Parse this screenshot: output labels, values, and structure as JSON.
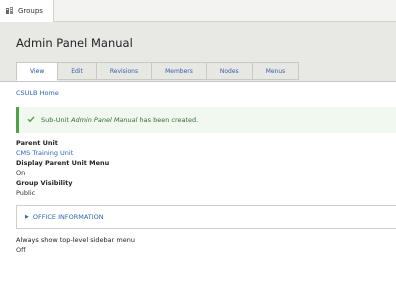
{
  "topbar": {
    "tab_label": "Groups"
  },
  "page": {
    "title": "Admin Panel Manual"
  },
  "tabs": [
    {
      "label": "View"
    },
    {
      "label": "Edit"
    },
    {
      "label": "Revisions"
    },
    {
      "label": "Members"
    },
    {
      "label": "Nodes"
    },
    {
      "label": "Menus"
    }
  ],
  "breadcrumb": {
    "label": "CSULB Home"
  },
  "message": {
    "prefix": "Sub-Unit",
    "name": "Admin Panel Manual",
    "suffix": "has been created."
  },
  "fields": {
    "parent_unit": {
      "label": "Parent Unit",
      "value": "CMS Training Unit"
    },
    "display_parent_unit_menu": {
      "label": "Display Parent Unit Menu",
      "value": "On"
    },
    "group_visibility": {
      "label": "Group Visibility",
      "value": "Public"
    },
    "sidebar_menu": {
      "label": "Always show top-level sidebar menu",
      "value": "Off"
    }
  },
  "details": {
    "summary": "Office Information"
  },
  "colors": {
    "accent": "#2a64b5",
    "success": "#4da34b"
  }
}
